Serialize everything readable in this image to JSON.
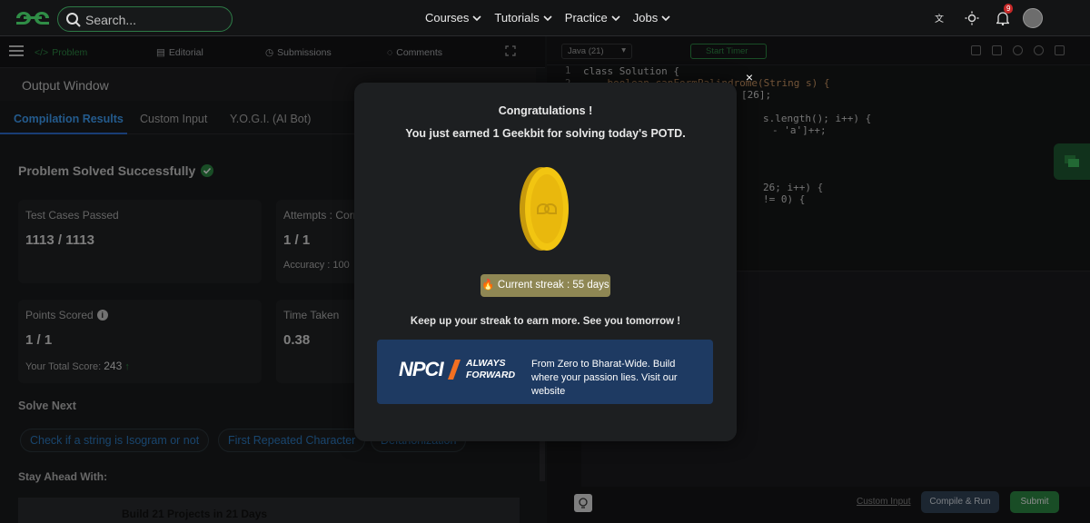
{
  "nav": {
    "search_placeholder": "Search...",
    "links": [
      "Courses",
      "Tutorials",
      "Practice",
      "Jobs"
    ],
    "notification_count": "9"
  },
  "left_tabs": {
    "problem": "Problem",
    "editorial": "Editorial",
    "submissions": "Submissions",
    "comments": "Comments"
  },
  "output": {
    "title": "Output Window",
    "tabs": [
      "Compilation Results",
      "Custom Input",
      "Y.O.G.I. (AI Bot)"
    ],
    "status": "Problem Solved Successfully",
    "test_cases_label": "Test Cases Passed",
    "test_cases_value": "1113 / 1113",
    "attempts_label": "Attempts : Corr",
    "attempts_value": "1 / 1",
    "accuracy_label": "Accuracy : 100",
    "points_label": "Points Scored",
    "points_value": "1 / 1",
    "total_score_label": "Your Total Score:",
    "total_score_value": "243",
    "time_label": "Time Taken",
    "time_value": "0.38",
    "solve_next": "Solve Next",
    "chips": [
      "Check if a string is Isogram or not",
      "First Repeated Character",
      "Defanonization"
    ],
    "stay_ahead": "Stay Ahead With:",
    "promo_title": "Build 21 Projects in 21 Days"
  },
  "editor": {
    "language": "Java (21)",
    "start_timer": "Start Timer",
    "line_numbers": [
      "1",
      "2"
    ],
    "code_lines": [
      "class Solution {",
      "    boolean canFormPalindrome(String s) {",
      "[26];",
      "s.length(); i++) {",
      "- 'a']++;",
      "26; i++) {",
      "!= 0) {"
    ],
    "custom_input": "Custom Input",
    "compile_run": "Compile & Run",
    "submit": "Submit"
  },
  "modal": {
    "title": "Congratulations !",
    "subtitle": "You just earned 1 Geekbit for solving today's POTD.",
    "streak": "Current streak : 55 days",
    "keep_up": "Keep up your streak to earn more. See you tomorrow !",
    "banner_brand": "NPCI",
    "banner_tagline": "ALWAYS FORWARD",
    "banner_text": "From Zero to Bharat-Wide. Build where your passion lies. Visit our website",
    "close": "×"
  },
  "colors": {
    "accent_green": "#2f8d46",
    "link_blue": "#2e7ec7",
    "streak_bg": "#8f8754",
    "banner_bg": "#1e3a62"
  }
}
